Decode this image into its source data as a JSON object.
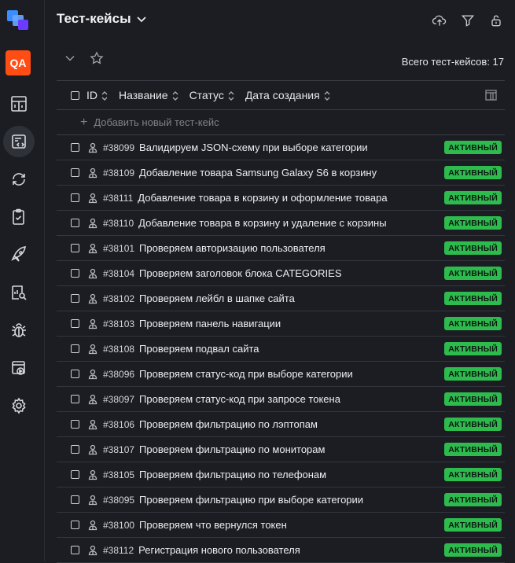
{
  "sidebar": {
    "qa_label": "QA",
    "items": [
      {
        "icon": "dashboard-icon"
      },
      {
        "icon": "test-cases-icon",
        "active": true
      },
      {
        "icon": "sync-icon"
      },
      {
        "icon": "test-plan-icon"
      },
      {
        "icon": "rocket-icon"
      },
      {
        "icon": "reports-icon"
      },
      {
        "icon": "bug-icon"
      },
      {
        "icon": "media-icon"
      },
      {
        "icon": "settings-icon"
      }
    ]
  },
  "header": {
    "title": "Тест-кейсы",
    "total_label": "Всего тест-кейсов: 17"
  },
  "table": {
    "columns": [
      "ID",
      "Название",
      "Статус",
      "Дата создания"
    ],
    "add_label": "Добавить новый тест-кейс",
    "rows": [
      {
        "id": "#38099",
        "name": "Валидируем JSON-схему при выборе категории",
        "status": "АКТИВНЫЙ"
      },
      {
        "id": "#38109",
        "name": "Добавление товара Samsung Galaxy S6 в корзину",
        "status": "АКТИВНЫЙ"
      },
      {
        "id": "#38111",
        "name": "Добавление товара в корзину и оформление товара",
        "status": "АКТИВНЫЙ"
      },
      {
        "id": "#38110",
        "name": "Добавление товара в корзину и удаление с корзины",
        "status": "АКТИВНЫЙ"
      },
      {
        "id": "#38101",
        "name": "Проверяем авторизацию пользователя",
        "status": "АКТИВНЫЙ"
      },
      {
        "id": "#38104",
        "name": "Проверяем заголовок блока CATEGORIES",
        "status": "АКТИВНЫЙ"
      },
      {
        "id": "#38102",
        "name": "Проверяем лейбл в шапке сайта",
        "status": "АКТИВНЫЙ"
      },
      {
        "id": "#38103",
        "name": "Проверяем панель навигации",
        "status": "АКТИВНЫЙ"
      },
      {
        "id": "#38108",
        "name": "Проверяем подвал сайта",
        "status": "АКТИВНЫЙ"
      },
      {
        "id": "#38096",
        "name": "Проверяем статус-код при выборе категории",
        "status": "АКТИВНЫЙ"
      },
      {
        "id": "#38097",
        "name": "Проверяем статус-код при запросе токена",
        "status": "АКТИВНЫЙ"
      },
      {
        "id": "#38106",
        "name": "Проверяем фильтрацию по лэптопам",
        "status": "АКТИВНЫЙ"
      },
      {
        "id": "#38107",
        "name": "Проверяем фильтрацию по мониторам",
        "status": "АКТИВНЫЙ"
      },
      {
        "id": "#38105",
        "name": "Проверяем фильтрацию по телефонам",
        "status": "АКТИВНЫЙ"
      },
      {
        "id": "#38095",
        "name": "Проверяем фильтрацию при выборе категории",
        "status": "АКТИВНЫЙ"
      },
      {
        "id": "#38100",
        "name": "Проверяем что вернулся токен",
        "status": "АКТИВНЫЙ"
      },
      {
        "id": "#38112",
        "name": "Регистрация нового пользователя",
        "status": "АКТИВНЫЙ"
      }
    ]
  },
  "colors": {
    "accent": "#ff4d14",
    "status_active": "#2dbb4e",
    "background": "#1b1d22"
  }
}
